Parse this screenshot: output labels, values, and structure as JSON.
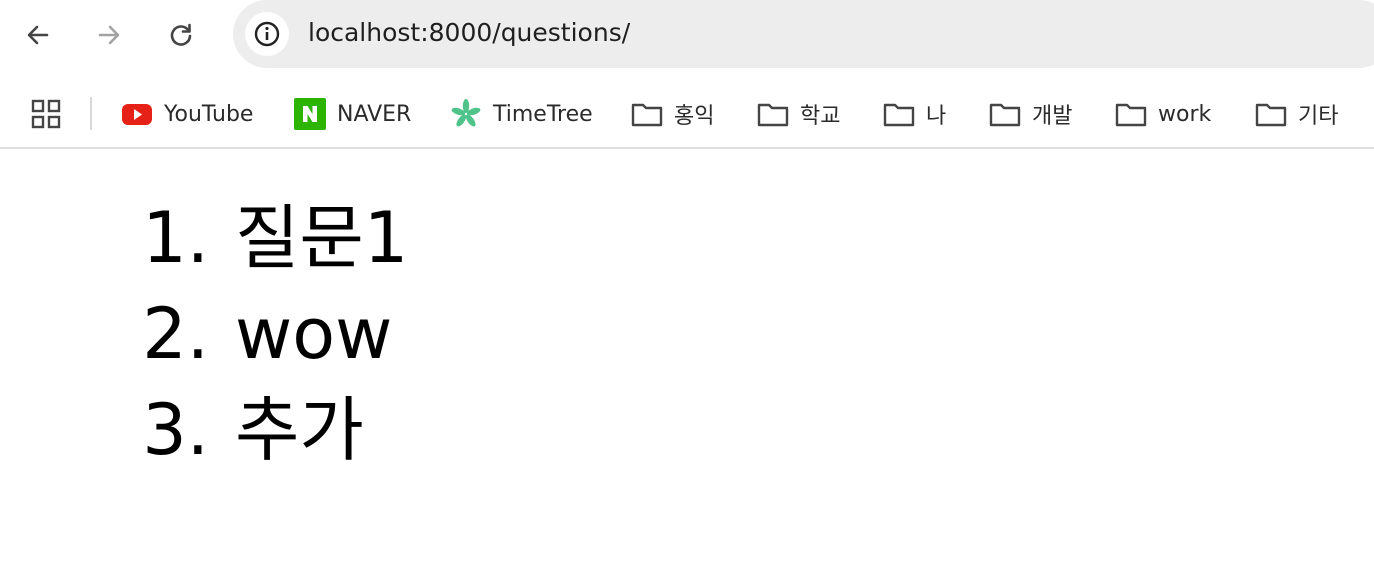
{
  "browser": {
    "url": "localhost:8000/questions/",
    "bookmarks": [
      {
        "label": "YouTube",
        "icon": "youtube-icon"
      },
      {
        "label": "NAVER",
        "icon": "naver-icon"
      },
      {
        "label": "TimeTree",
        "icon": "timetree-icon"
      },
      {
        "label": "홍익",
        "icon": "folder-icon"
      },
      {
        "label": "학교",
        "icon": "folder-icon"
      },
      {
        "label": "나",
        "icon": "folder-icon"
      },
      {
        "label": "개발",
        "icon": "folder-icon"
      },
      {
        "label": "work",
        "icon": "folder-icon"
      },
      {
        "label": "기타",
        "icon": "folder-icon"
      }
    ]
  },
  "page": {
    "questions": [
      {
        "number": "1.",
        "text": "질문1"
      },
      {
        "number": "2.",
        "text": "wow"
      },
      {
        "number": "3.",
        "text": "추가"
      }
    ]
  },
  "colors": {
    "omnibox_bg": "#eeedee",
    "youtube_red": "#e62117",
    "naver_green": "#2db400",
    "timetree_green": "#4fc38a"
  }
}
